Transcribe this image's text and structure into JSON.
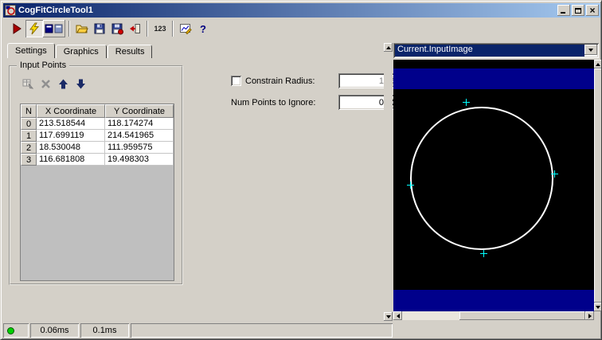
{
  "colors": {
    "titlebar_gradient_start": "#0a246a",
    "titlebar_gradient_end": "#a6caf0",
    "window_face": "#d4d0c8",
    "selection": "#0a246a",
    "image_background": "#000000",
    "image_band": "#00008b",
    "fit_circle": "#ffffff",
    "point_marker": "#00ffff",
    "status_led": "#00d000"
  },
  "window": {
    "title": "CogFitCircleTool1"
  },
  "toolbar": {
    "buttons": [
      {
        "name": "run-button",
        "icon": "play-icon"
      },
      {
        "name": "electric-run-button",
        "icon": "lightning-icon",
        "pressed": true
      },
      {
        "name": "view-toggle-button",
        "icon": "panels-icon"
      },
      {
        "name": "open-button",
        "icon": "folder-open-icon"
      },
      {
        "name": "save-button",
        "icon": "floppy-icon"
      },
      {
        "name": "save-results-button",
        "icon": "floppy-dot-icon"
      },
      {
        "name": "revert-button",
        "icon": "revert-arrow-icon"
      },
      {
        "name": "numeric-format-button",
        "label": "123"
      },
      {
        "name": "expression-button",
        "icon": "chart-pencil-icon"
      },
      {
        "name": "help-button",
        "label": "?"
      }
    ]
  },
  "tabs": [
    {
      "label": "Settings",
      "active": true
    },
    {
      "label": "Graphics",
      "active": false
    },
    {
      "label": "Results",
      "active": false
    }
  ],
  "input_points": {
    "group_label": "Input Points",
    "columns": [
      "N",
      "X Coordinate",
      "Y Coordinate"
    ],
    "rows": [
      {
        "n": "0",
        "x": "213.518544",
        "y": "118.174274"
      },
      {
        "n": "1",
        "x": "117.699119",
        "y": "214.541965"
      },
      {
        "n": "2",
        "x": "18.530048",
        "y": "111.959575"
      },
      {
        "n": "3",
        "x": "116.681808",
        "y": "19.498303"
      }
    ]
  },
  "settings": {
    "constrain_radius_label": "Constrain Radius:",
    "constrain_radius_checked": false,
    "constrain_radius_value": "1",
    "num_points_label": "Num Points to Ignore:",
    "num_points_value": "0"
  },
  "image_panel": {
    "selected_buffer": "Current.InputImage"
  },
  "status_bar": {
    "process_time": "0.06ms",
    "total_time": "0.1ms"
  }
}
